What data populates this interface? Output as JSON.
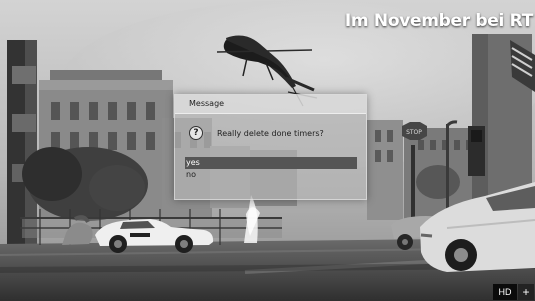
{
  "overlay": {
    "promo_title": "Im November bei RT"
  },
  "dialog": {
    "title": "Message",
    "question_icon": "?",
    "question": "Really delete done timers?",
    "choices": [
      {
        "label": "yes",
        "selected": true
      },
      {
        "label": "no",
        "selected": false
      }
    ]
  },
  "footer": {
    "hd_badge": "HD",
    "plus_symbol": "+"
  },
  "icons": {
    "question": "question-icon",
    "plus": "plus-icon"
  },
  "colors": {
    "dialog_bg": "#B4B4B4",
    "selection_bg": "#555555",
    "badge_bg": "#0B0B0B"
  }
}
